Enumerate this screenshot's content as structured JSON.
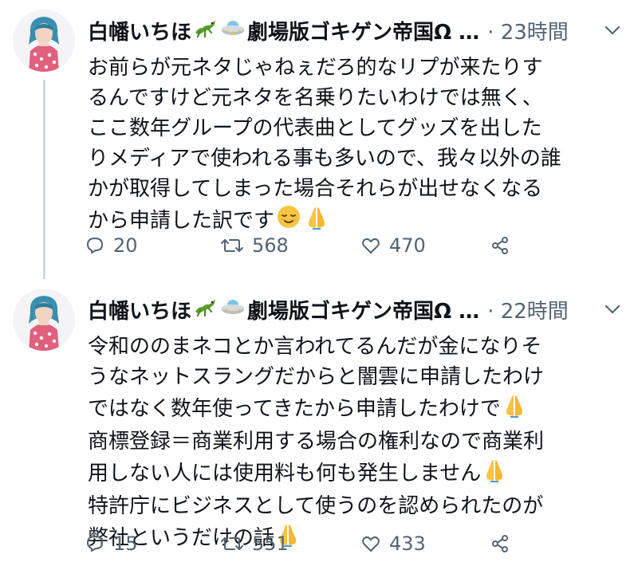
{
  "tweets": [
    {
      "author": {
        "name_before_emoji": "白幡いちほ",
        "name_after_emoji": "劇場版ゴキゲン帝国Ω …",
        "emojis": [
          "lizard-emoji",
          "flying-saucer-emoji"
        ]
      },
      "time": "· 23時間",
      "lines": [
        "お前らが元ネタじゃねぇだろ的なリプが来たりす",
        "るんですけど元ネタを名乗りたいわけでは無く、",
        "ここ数年グループの代表曲としてグッズを出した",
        "りメディアで使われる事も多いので、我々以外の誰",
        "かが取得してしまった場合それらが出せなくなる",
        "から申請した訳です"
      ],
      "trailing_emojis": [
        "relieved-face-emoji",
        "folded-hands-emoji"
      ],
      "counts": {
        "replies": "20",
        "retweets": "568",
        "likes": "470"
      }
    },
    {
      "author": {
        "name_before_emoji": "白幡いちほ",
        "name_after_emoji": "劇場版ゴキゲン帝国Ω …",
        "emojis": [
          "lizard-emoji",
          "flying-saucer-emoji"
        ]
      },
      "time": "· 22時間",
      "lines": [
        "令和ののまネコとか言われてるんだが金になりそ",
        "うなネットスラングだからと闇雲に申請したわけ",
        "ではなく数年使ってきたから申請したわけで",
        "商標登録＝商業利用する場合の権利なので商業利",
        "用しない人には使用料も何も発生しません",
        "特許庁にビジネスとして使うのを認められたのが",
        "弊社というだけの話"
      ],
      "line_emojis": {
        "2": "folded-hands-emoji",
        "4": "folded-hands-emoji",
        "6": "folded-hands-emoji"
      },
      "counts": {
        "replies": "15",
        "retweets": "551",
        "likes": "433"
      }
    }
  ],
  "colors": {
    "text": "#0f1419",
    "secondary": "#536471",
    "thread_line": "#cfd9de",
    "background": "#ffffff"
  }
}
